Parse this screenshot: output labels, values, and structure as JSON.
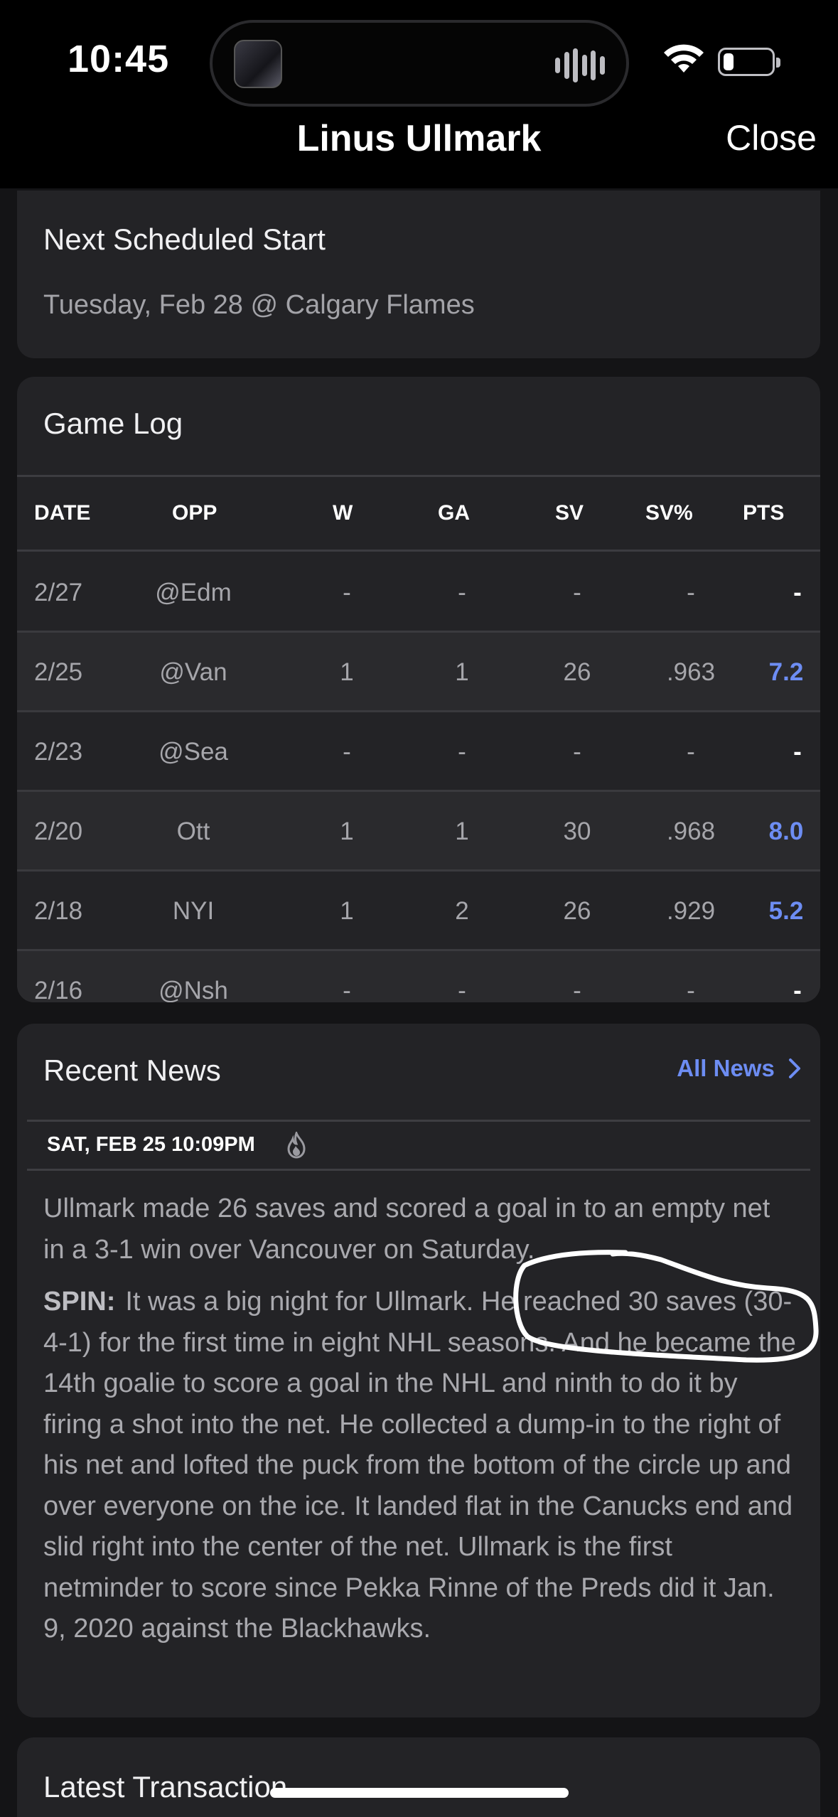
{
  "status_bar": {
    "time": "10:45"
  },
  "header": {
    "title": "Linus Ullmark",
    "close_label": "Close"
  },
  "next_start": {
    "title": "Next Scheduled Start",
    "subtitle": "Tuesday, Feb 28 @ Calgary Flames"
  },
  "game_log": {
    "title": "Game Log",
    "columns": [
      "DATE",
      "OPP",
      "W",
      "GA",
      "SV",
      "SV%",
      "PTS"
    ],
    "rows": [
      {
        "date": "2/27",
        "opp": "@Edm",
        "w": "-",
        "ga": "-",
        "sv": "-",
        "svp": "-",
        "pts": "-"
      },
      {
        "date": "2/25",
        "opp": "@Van",
        "w": "1",
        "ga": "1",
        "sv": "26",
        "svp": ".963",
        "pts": "7.2"
      },
      {
        "date": "2/23",
        "opp": "@Sea",
        "w": "-",
        "ga": "-",
        "sv": "-",
        "svp": "-",
        "pts": "-"
      },
      {
        "date": "2/20",
        "opp": "Ott",
        "w": "1",
        "ga": "1",
        "sv": "30",
        "svp": ".968",
        "pts": "8.0"
      },
      {
        "date": "2/18",
        "opp": "NYI",
        "w": "1",
        "ga": "2",
        "sv": "26",
        "svp": ".929",
        "pts": "5.2"
      },
      {
        "date": "2/16",
        "opp": "@Nsh",
        "w": "-",
        "ga": "-",
        "sv": "-",
        "svp": "-",
        "pts": "-"
      }
    ]
  },
  "recent_news": {
    "title": "Recent News",
    "all_news_label": "All News",
    "timestamp": "SAT, FEB 25 10:09PM",
    "headline": "Ullmark made 26 saves and scored a goal in to an empty net in a 3-1 win over Vancouver on Saturday.",
    "spin_label": "SPIN:",
    "spin_text": "It was a big night for Ullmark. He reached 30 saves (30-4-1) for the first time in eight NHL seasons. And he became the 14th goalie to score a goal in the NHL and ninth to do it by firing a shot into the net. He collected a dump-in to the right of his net and lofted the puck from the bottom of the circle up and over everyone on the ice. It landed flat in the Canucks end and slid right into the center of the net. Ullmark is the first netminder to score since Pekka Rinne of the Preds did it Jan. 9, 2020 against the Blackhawks."
  },
  "latest_transaction": {
    "title": "Latest Transaction"
  },
  "colors": {
    "accent": "#6d8df3",
    "background": "#141416",
    "card": "#232326"
  }
}
